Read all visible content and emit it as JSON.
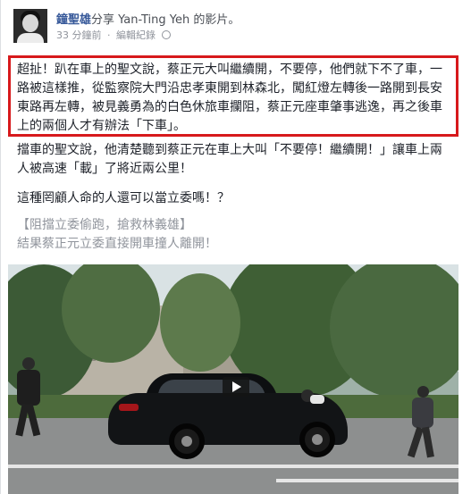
{
  "post": {
    "author": "鐘聖雄",
    "share_text": "分享 Yan-Ting Yeh 的影片。",
    "time": "33 分鐘前",
    "separator": "·",
    "edit_history": "編輯紀錄"
  },
  "content": {
    "highlighted_lines": [
      "超扯！趴在車上的聖文說，蔡正元大叫繼續開，不要停，他們就下不了車，一",
      "路被這樣推，從監察院大門沿忠孝東開到林森北，闖紅燈左轉後一路開到長安",
      "東路再左轉，被見義勇為的白色休旅車攔阻，蔡正元座車肇事逃逸，再之後車",
      "上的兩個人才有辦法「下車」。"
    ],
    "paragraph2_lines": [
      "擋車的聖文說，他清楚聽到蔡正元在車上大叫「不要停！繼續開！」讓車上兩",
      "人被高速「載」了將近兩公里！"
    ],
    "paragraph3": "這種罔顧人命的人還可以當立委嗎！？",
    "video_title_lines": [
      "【阻擋立委偷跑，搶救林義雄】",
      "結果蔡正元立委直接開車撞人離開！"
    ]
  },
  "video": {
    "play_icon": "play-icon"
  },
  "colors": {
    "author": "#365899",
    "highlight_border": "#d7191c",
    "meta": "#90949c"
  }
}
